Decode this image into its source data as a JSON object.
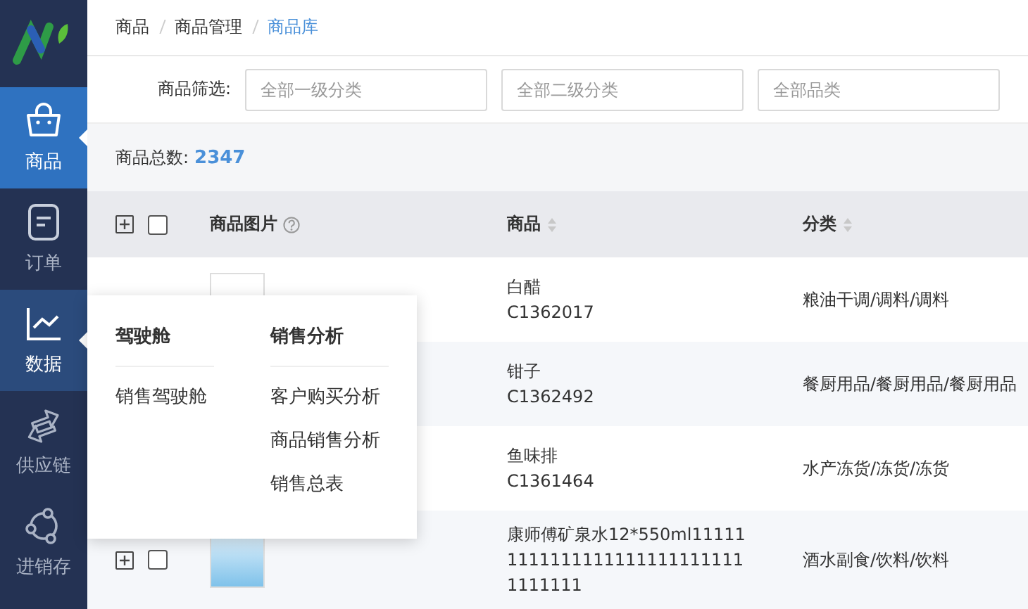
{
  "sidebar": {
    "items": [
      {
        "label": "商品",
        "selected": true,
        "expanded": false
      },
      {
        "label": "订单",
        "selected": false,
        "expanded": false
      },
      {
        "label": "数据",
        "selected": false,
        "expanded": true
      },
      {
        "label": "供应链",
        "selected": false,
        "expanded": false
      },
      {
        "label": "进销存",
        "selected": false,
        "expanded": false
      }
    ]
  },
  "breadcrumb": [
    {
      "label": "商品",
      "current": false
    },
    {
      "label": "商品管理",
      "current": false
    },
    {
      "label": "商品库",
      "current": true
    }
  ],
  "filter": {
    "label": "商品筛选:",
    "fields": [
      {
        "placeholder": "全部一级分类"
      },
      {
        "placeholder": "全部二级分类"
      },
      {
        "placeholder": "全部品类"
      }
    ]
  },
  "summary": {
    "label": "商品总数:",
    "value": "2347"
  },
  "table": {
    "header": {
      "expanded": false,
      "checked": false
    },
    "columns": [
      {
        "label": "商品图片",
        "help": true,
        "sortable": false
      },
      {
        "label": "商品",
        "help": false,
        "sortable": true
      },
      {
        "label": "分类",
        "help": false,
        "sortable": true
      }
    ],
    "rows": [
      {
        "name": "白醋",
        "code": "C1362017",
        "category": "粮油干调/调料/调料"
      },
      {
        "name": "钳子",
        "code": "C1362492",
        "category": "餐厨用品/餐厨用品/餐厨用品"
      },
      {
        "name": "鱼味排",
        "code": "C1361464",
        "category": "水产冻货/冻货/冻货"
      },
      {
        "name": "康师傅矿泉水12*550ml1111111111111111111111111111111111",
        "category": "酒水副食/饮料/饮料",
        "expanded": false,
        "checked": false
      }
    ]
  },
  "popup_menu": {
    "columns": [
      {
        "title": "驾驶舱",
        "items": [
          "销售驾驶舱"
        ]
      },
      {
        "title": "销售分析",
        "items": [
          "客户购买分析",
          "商品销售分析",
          "销售总表"
        ]
      }
    ]
  }
}
